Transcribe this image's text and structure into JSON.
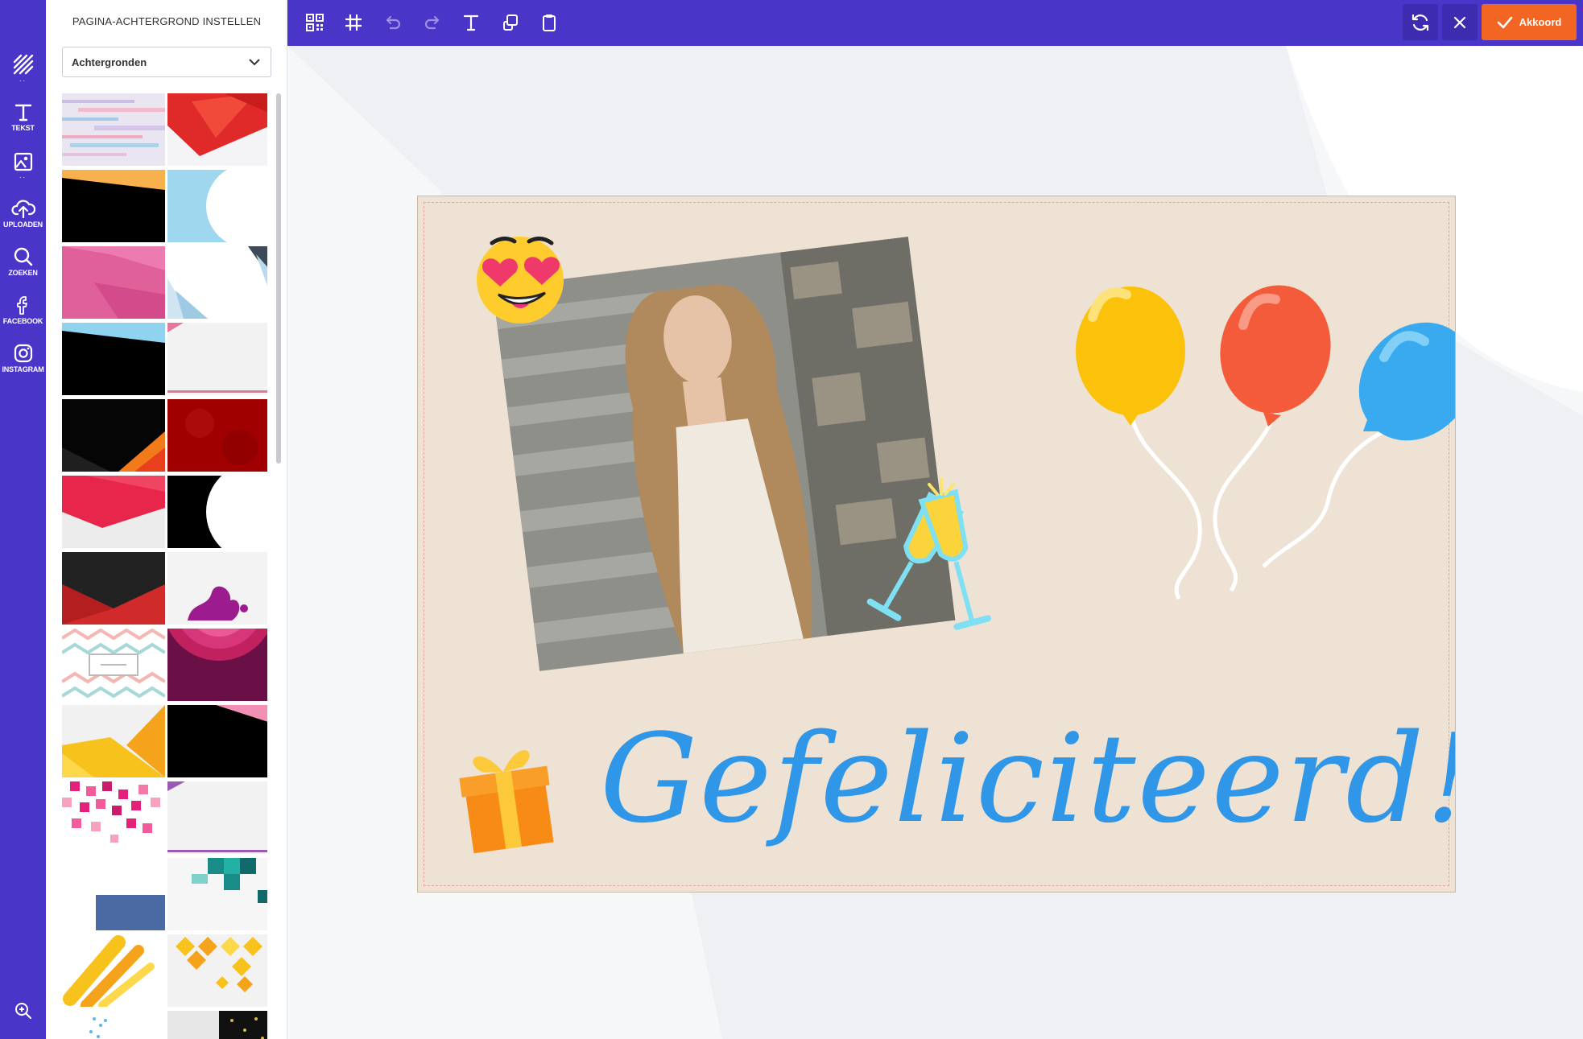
{
  "panel": {
    "title": "PAGINA-ACHTERGROND INSTELLEN",
    "dropdown_value": "Achtergronden"
  },
  "rail": {
    "items": [
      {
        "label": "",
        "icon": "pattern-icon",
        "dots": ".."
      },
      {
        "label": "TEKST",
        "icon": "text-icon"
      },
      {
        "label": "",
        "icon": "image-icon",
        "dots": ".."
      },
      {
        "label": "UPLOADEN",
        "icon": "upload-icon"
      },
      {
        "label": "ZOEKEN",
        "icon": "search-icon"
      },
      {
        "label": "FACEBOOK",
        "icon": "facebook-icon"
      },
      {
        "label": "INSTAGRAM",
        "icon": "instagram-icon"
      }
    ],
    "zoom_icon": "zoom-in-icon"
  },
  "toolbar": {
    "tools": [
      "qr-code-icon",
      "grid-icon",
      "undo-icon",
      "redo-icon",
      "text-icon",
      "layers-icon",
      "clipboard-icon"
    ],
    "refresh_icon": "refresh-icon",
    "close_icon": "close-icon",
    "ok_label": "Akkoord"
  },
  "card": {
    "greeting": "Gefeliciteerd!",
    "stickers": [
      "heart-eyes-emoji",
      "champagne-glasses",
      "balloons-yellow-red-blue",
      "gift-box"
    ]
  },
  "colors": {
    "brand": "#4a35c9",
    "accent": "#f26522",
    "greeting": "#2f96e8",
    "card_bg": "#ede2d3"
  },
  "thumbnails": [
    "pastel-streaks",
    "red-polygon",
    "orange-black-diagonal",
    "lightblue-white-circle",
    "pink-angular",
    "white-geometric-corner",
    "blue-black-diagonal",
    "white-pink-line",
    "black-orange-corner",
    "dark-red-texture",
    "red-white-polygon",
    "black-white-curve",
    "dark-red-fold",
    "purple-splash",
    "chevron-pattern",
    "purple-arcs",
    "yellow-polygon",
    "black-pink-diagonal",
    "pink-pixels",
    "white-purple-lines",
    "white-blue-block",
    "teal-squares",
    "yellow-brush",
    "yellow-diamonds",
    "white-blue-dots",
    "gray-black-dots"
  ]
}
